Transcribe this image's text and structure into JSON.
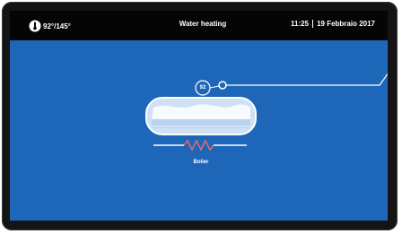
{
  "statusbar": {
    "temperature": "92°/145°",
    "title": "Water heating",
    "time": "11:25",
    "date": "19 Febbraio 2017"
  },
  "diagram": {
    "sensor_value": "92",
    "boiler_label": "Boiler"
  },
  "colors": {
    "screen_background": "#1e67b8",
    "statusbar_background": "#050505",
    "device_bezel": "#141414",
    "tank_fill": "#d6e6f6",
    "line": "#ffffff",
    "heater": "#e86a6a"
  },
  "icons": {
    "temperature": "thermometer-icon",
    "sensor": "temperature-sensor-icon",
    "heater": "heating-element-icon"
  }
}
